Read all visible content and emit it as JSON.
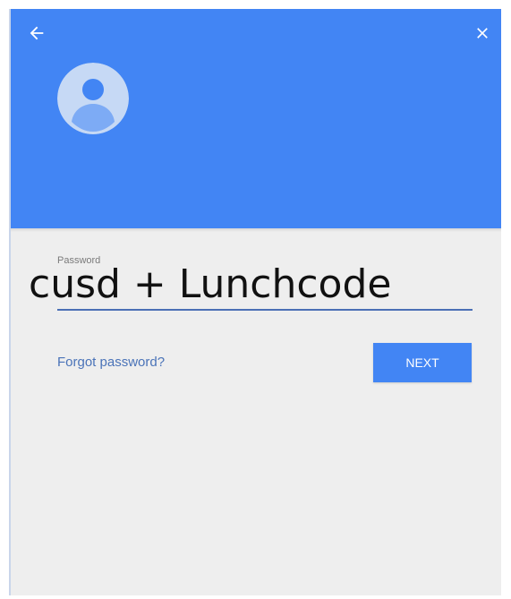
{
  "colors": {
    "header_bg": "#4285f4",
    "body_bg": "#eeeeee",
    "link": "#4a73b8",
    "button_bg": "#4285f4",
    "underline": "#4a6fb5"
  },
  "header": {
    "back_icon": "arrow-left-icon",
    "close_icon": "close-icon",
    "avatar_icon": "account-circle-icon"
  },
  "password_field": {
    "label": "Password",
    "value": "cusd + Lunchcode"
  },
  "actions": {
    "forgot_label": "Forgot password?",
    "next_label": "NEXT"
  }
}
